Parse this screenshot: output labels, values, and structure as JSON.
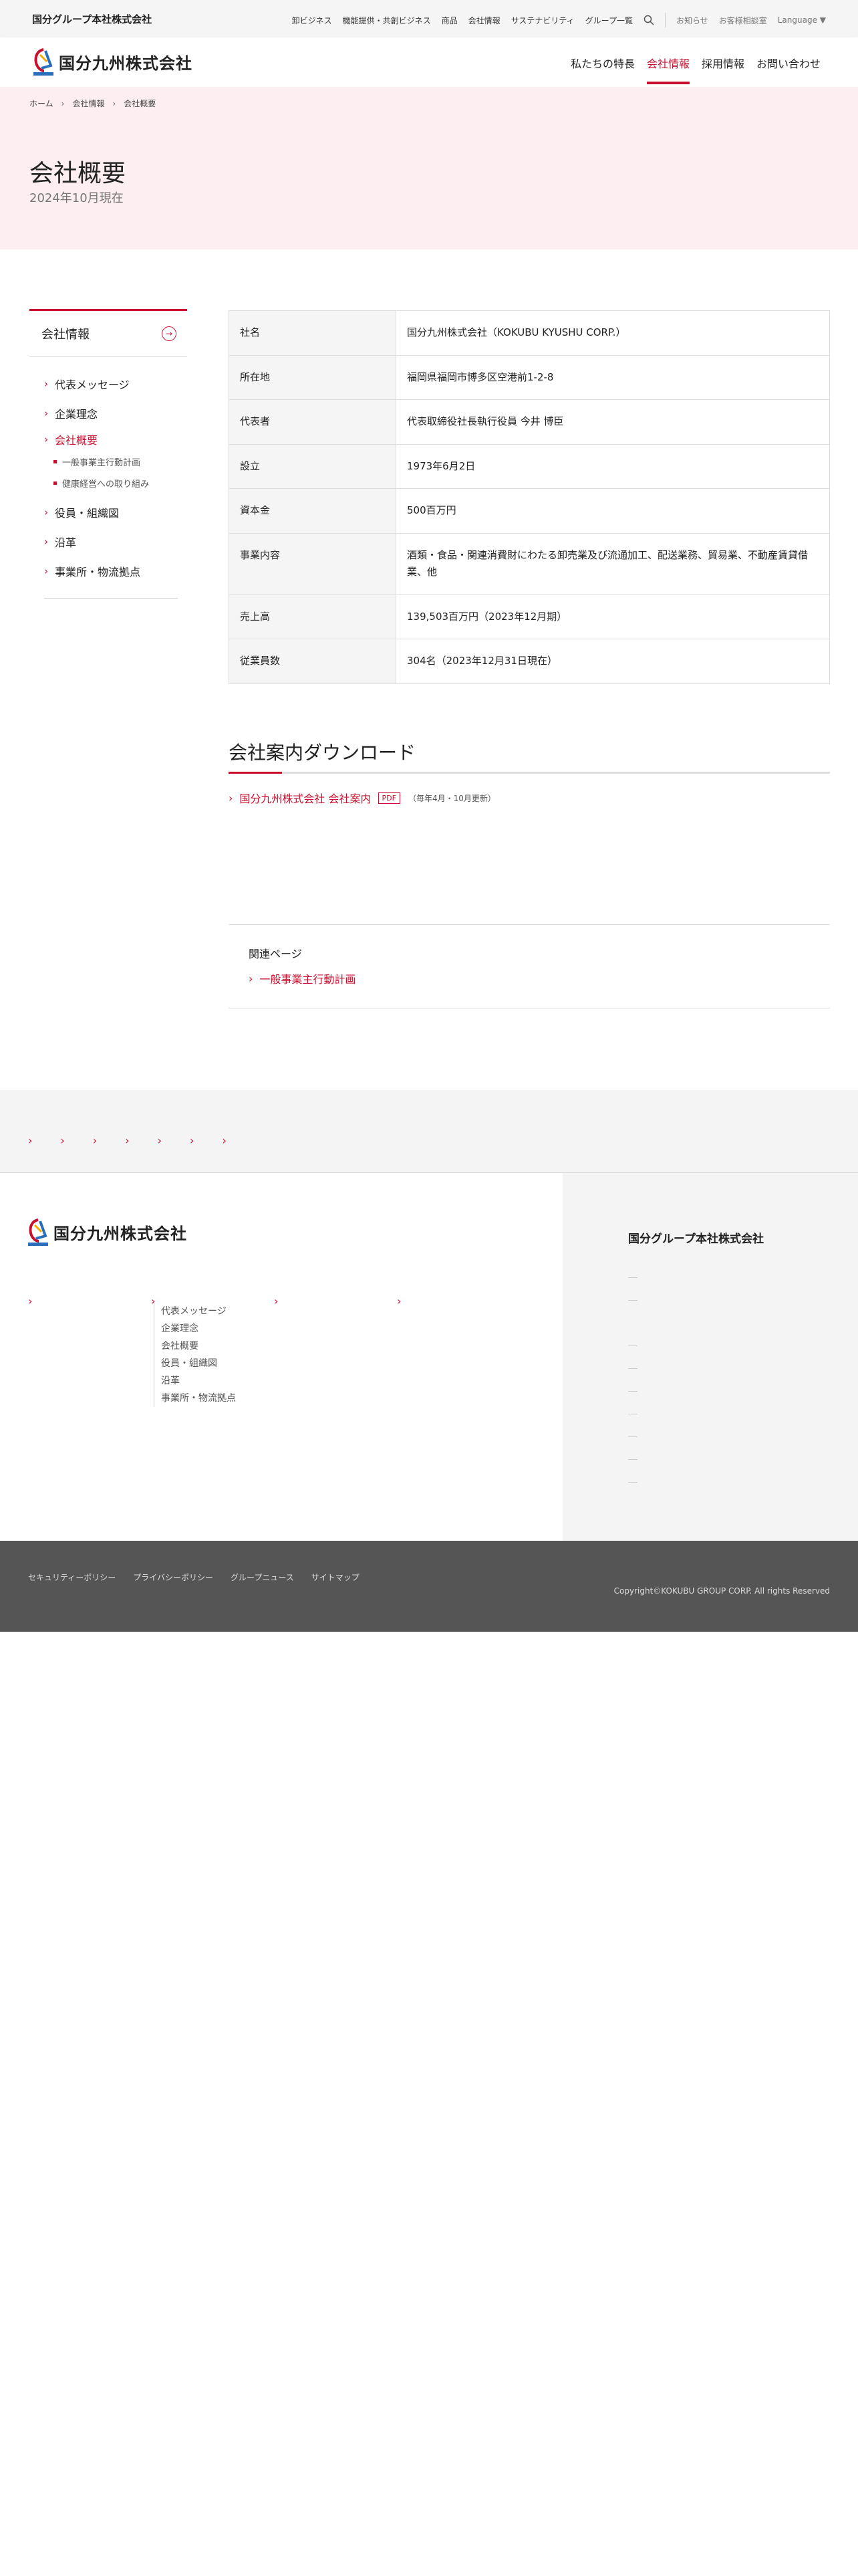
{
  "topbar": {
    "group_name": "国分グループ本社株式会社",
    "nav": [
      "卸ビジネス",
      "機能提供・共創ビジネス",
      "商品",
      "会社情報",
      "サステナビリティ",
      "グループ一覧"
    ],
    "search_icon": "search-icon",
    "util": [
      "お知らせ",
      "お客様相談室",
      "Language ▼"
    ]
  },
  "header": {
    "company_name": "国分九州株式会社",
    "nav": [
      "私たちの特長",
      "会社情報",
      "採用情報",
      "お問い合わせ"
    ],
    "active": "会社情報",
    "accent_color": "#c8102e"
  },
  "breadcrumb": [
    "ホーム",
    "会社情報",
    "会社概要"
  ],
  "page": {
    "title": "会社概要",
    "subtitle": "2024年10月現在"
  },
  "sidebar": {
    "title": "会社情報",
    "items": [
      {
        "label": "代表メッセージ"
      },
      {
        "label": "企業理念"
      },
      {
        "label": "会社概要",
        "active": true
      },
      {
        "label": "役員・組織図"
      },
      {
        "label": "沿革"
      },
      {
        "label": "事業所・物流拠点"
      }
    ],
    "subitems": [
      "一般事業主行動計画",
      "健康経営への取り組み"
    ]
  },
  "profile": [
    {
      "k": "社名",
      "v": "国分九州株式会社（KOKUBU KYUSHU CORP.）"
    },
    {
      "k": "所在地",
      "v": "福岡県福岡市博多区空港前1-2-8"
    },
    {
      "k": "代表者",
      "v": "代表取締役社長執行役員 今井 博臣"
    },
    {
      "k": "設立",
      "v": "1973年6月2日"
    },
    {
      "k": "資本金",
      "v": "500百万円"
    },
    {
      "k": "事業内容",
      "v": "酒類・食品・関連消費財にわたる卸売業及び流通加工、配送業務、貿易業、不動産賃貸借業、他"
    },
    {
      "k": "売上高",
      "v": "139,503百万円（2023年12月期）"
    },
    {
      "k": "従業員数",
      "v": "304名（2023年12月31日現在）"
    }
  ],
  "download": {
    "title": "会社案内ダウンロード",
    "link": "国分九州株式会社 会社案内",
    "badge": "PDF",
    "note": "（毎年4月・10月更新）"
  },
  "related": {
    "title": "関連ページ",
    "link": "一般事業主行動計画"
  },
  "footer": {
    "company_name": "国分九州株式会社",
    "links": [
      "代表メッセージ",
      "企業理念",
      "会社概要",
      "役員・組織図",
      "沿革",
      "事業所・物流拠点"
    ],
    "group_title": "国分グループ本社株式会社"
  },
  "bottom": {
    "links": [
      "セキュリティーポリシー",
      "プライバシーポリシー",
      "グループニュース",
      "サイトマップ"
    ],
    "copyright": "Copyright©KOKUBU GROUP CORP. All rights Reserved"
  }
}
